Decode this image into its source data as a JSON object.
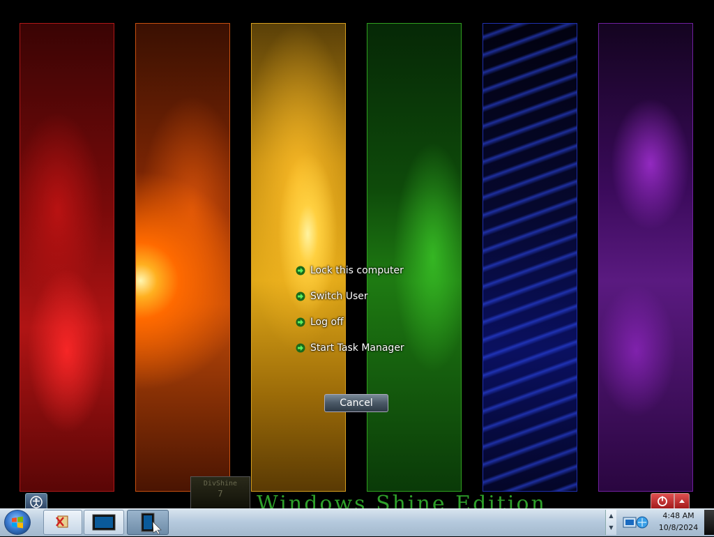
{
  "menu": {
    "items": [
      {
        "label": "Lock this computer"
      },
      {
        "label": "Switch User"
      },
      {
        "label": "Log off"
      },
      {
        "label": "Start Task Manager"
      }
    ]
  },
  "cancel_label": "Cancel",
  "branding": {
    "box_line1": "DivShine",
    "box_line2": "7",
    "edition_text": "Windows Shine Edition"
  },
  "clock": {
    "time": "4:48 AM",
    "date": "10/8/2024"
  },
  "icons": {
    "menu_arrow": "green-arrow-icon",
    "power": "power-icon",
    "ease_of_access": "ease-of-access-icon",
    "start": "windows-start-orb",
    "network": "network-icon"
  },
  "colors": {
    "menu_arrow": "#3cc83c",
    "edition_text": "#2ea02a",
    "power_button": "#c02828"
  }
}
